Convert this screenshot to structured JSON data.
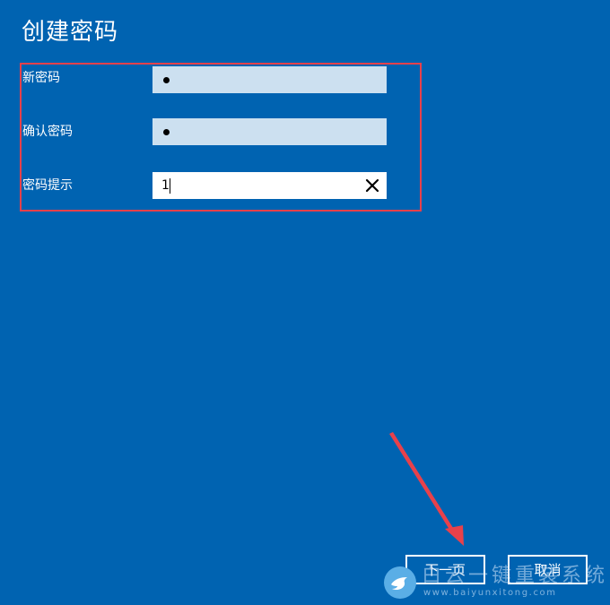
{
  "page_title": "创建密码",
  "fields": [
    {
      "label": "新密码",
      "masked_value": "•"
    },
    {
      "label": "确认密码",
      "masked_value": "•"
    },
    {
      "label": "密码提示",
      "value": "1"
    }
  ],
  "buttons": {
    "next": "下一页",
    "cancel": "取消"
  },
  "watermark": {
    "name": "白云一键重装系统",
    "url": "www.baiyunxitong.com"
  },
  "colors": {
    "background": "#0063b1",
    "highlight": "#e8414b",
    "field_filled": "#cce0f0",
    "arrow": "#e8414b"
  },
  "icons": {
    "clear": "close-icon",
    "watermark_logo": "bird-icon"
  }
}
